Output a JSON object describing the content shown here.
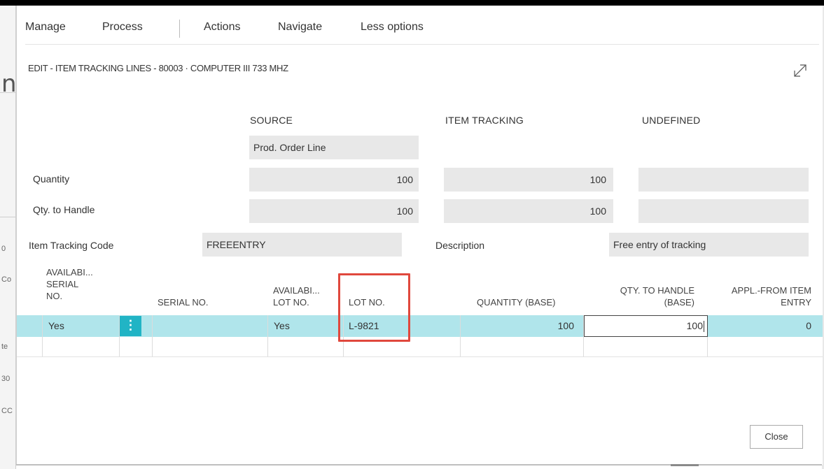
{
  "menu": {
    "manage": "Manage",
    "process": "Process",
    "actions": "Actions",
    "navigate": "Navigate",
    "less_options": "Less options"
  },
  "dialog": {
    "title": "EDIT - ITEM TRACKING LINES - 80003 · COMPUTER III 733 MHZ",
    "expand_icon": "expand-icon"
  },
  "summary": {
    "headers": {
      "source": "SOURCE",
      "item_tracking": "ITEM TRACKING",
      "undefined": "UNDEFINED"
    },
    "source_type": "Prod. Order Line",
    "quantity": {
      "label": "Quantity",
      "source": "100",
      "item_tracking": "100",
      "undefined": ""
    },
    "qty_to_handle": {
      "label": "Qty. to Handle",
      "source": "100",
      "item_tracking": "100",
      "undefined": ""
    },
    "item_tracking_code": {
      "label": "Item Tracking Code",
      "value": "FREEENTRY"
    },
    "description": {
      "label": "Description",
      "value": "Free entry of tracking"
    }
  },
  "grid": {
    "columns": {
      "avail_serial": [
        "AVAILABI...",
        "SERIAL",
        "NO."
      ],
      "serial_no": "SERIAL NO.",
      "avail_lot": [
        "AVAILABI...",
        "LOT NO."
      ],
      "lot_no": "LOT NO.",
      "quantity_base": "QUANTITY (BASE)",
      "qty_to_handle_base": [
        "QTY. TO HANDLE",
        "(BASE)"
      ],
      "appl_from_item_entry": [
        "APPL.-FROM ITEM",
        "ENTRY"
      ]
    },
    "rows": [
      {
        "avail_serial": "Yes",
        "serial_no": "",
        "avail_lot": "Yes",
        "lot_no": "L-9821",
        "quantity_base": "100",
        "qty_to_handle_base": "100",
        "appl_from_item_entry": "0"
      }
    ],
    "row_menu_glyph": "⋮"
  },
  "background_fragments": [
    "0",
    "Co",
    "te",
    "30",
    "CC"
  ],
  "background_title_char": "n",
  "buttons": {
    "close": "Close"
  },
  "colors": {
    "selected_row": "#b0e5eb",
    "accent": "#21b4c5",
    "highlight_box": "#e0483d"
  }
}
